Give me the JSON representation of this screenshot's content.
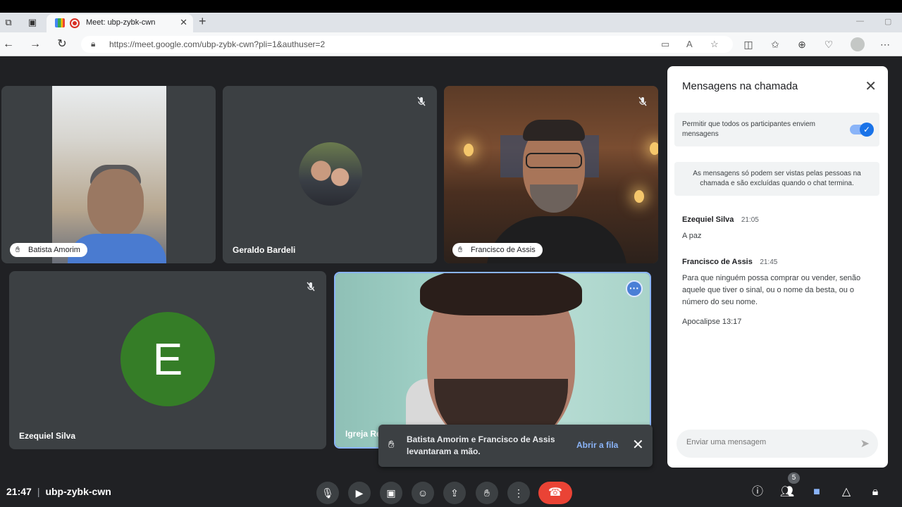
{
  "browser": {
    "tab_title": "Meet: ubp-zybk-cwn",
    "url": "https://meet.google.com/ubp-zybk-cwn?pli=1&authuser=2",
    "new_tab_icon": "plus-icon"
  },
  "participants": [
    {
      "name": "Batista Amorim",
      "hand_raised": true
    },
    {
      "name": "Geraldo Bardeli",
      "muted": true
    },
    {
      "name": "Francisco de Assis",
      "hand_raised": true,
      "muted": true
    },
    {
      "name": "Ezequiel Silva",
      "initial": "E",
      "muted": true,
      "avatar_color": "#357d27"
    },
    {
      "name": "Igreja Re",
      "active_speaker": true
    }
  ],
  "toast": {
    "message": "Batista Amorim e Francisco de Assis levantaram a mão.",
    "action": "Abrir a fila"
  },
  "chat_panel": {
    "title": "Mensagens na chamada",
    "setting_label": "Permitir que todos os participantes enviem mensagens",
    "setting_enabled": true,
    "info": "As mensagens só podem ser vistas pelas pessoas na chamada e são excluídas quando o chat termina.",
    "messages": [
      {
        "author": "Ezequiel Silva",
        "time": "21:05",
        "text": "A paz"
      },
      {
        "author": "Francisco de Assis",
        "time": "21:45",
        "text": "Para que ninguém possa comprar ou vender, senão aquele que tiver o sinal, ou o nome da besta, ou o número do seu nome."
      }
    ],
    "extra_line": "Apocalipse 13:17",
    "input_placeholder": "Enviar uma mensagem"
  },
  "bottom_bar": {
    "time": "21:47",
    "meeting_code": "ubp-zybk-cwn",
    "people_count": "5"
  },
  "colors": {
    "accent": "#1a73e8",
    "hangup": "#ea4335",
    "background": "#202124"
  }
}
